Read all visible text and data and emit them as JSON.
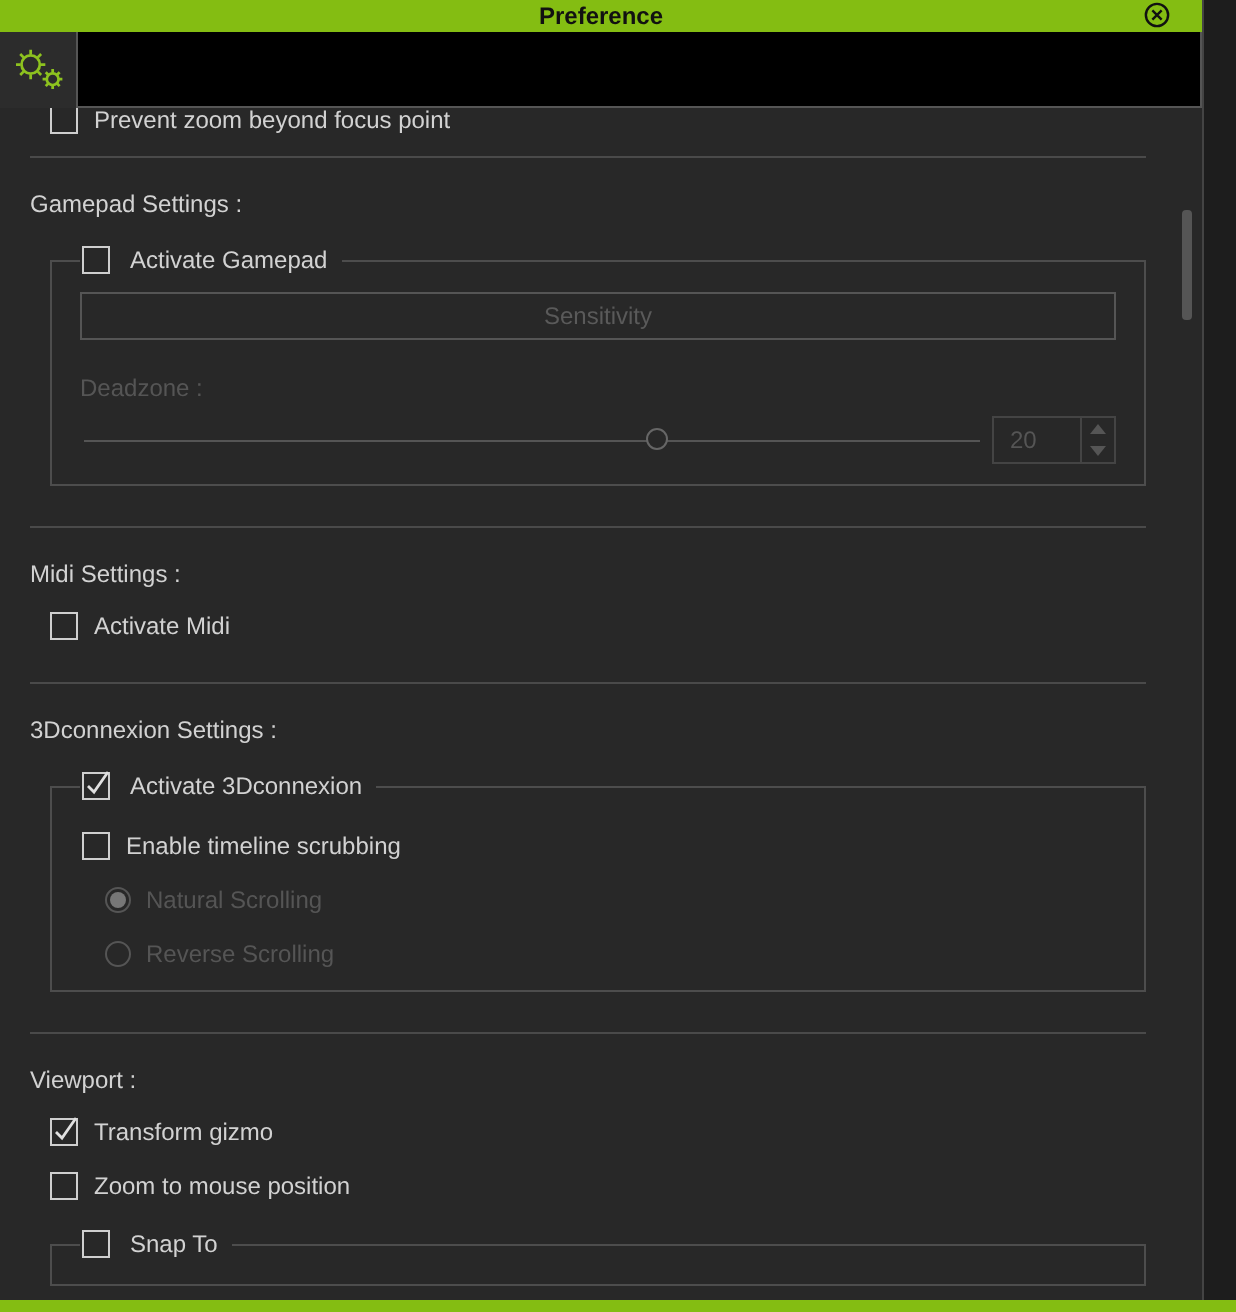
{
  "window": {
    "title": "Preference"
  },
  "top_option": {
    "label": "Prevent zoom beyond focus point",
    "checked": false
  },
  "sections": [
    {
      "title": "Gamepad Settings :",
      "group": {
        "label": "Activate Gamepad",
        "checked": false,
        "button": {
          "label": "Sensitivity",
          "disabled": true
        },
        "slider": {
          "label": "Deadzone :",
          "level": 0.64,
          "value": "20",
          "disabled": true
        }
      }
    },
    {
      "title": "Midi Settings :",
      "options": [
        {
          "label": "Activate Midi",
          "checked": false
        }
      ]
    },
    {
      "title": "3Dconnexion Settings :",
      "group": {
        "label": "Activate 3Dconnexion",
        "checked": true,
        "options": [
          {
            "label": "Enable timeline scrubbing",
            "checked": false
          }
        ],
        "radios": [
          {
            "label": "Natural Scrolling",
            "selected": true,
            "disabled": true
          },
          {
            "label": "Reverse Scrolling",
            "selected": false,
            "disabled": true
          }
        ]
      }
    },
    {
      "title": "Viewport :",
      "options": [
        {
          "label": "Transform gizmo",
          "checked": true
        },
        {
          "label": "Zoom to mouse position",
          "checked": false
        }
      ],
      "group": {
        "label": "Snap To",
        "checked": false
      }
    }
  ]
}
